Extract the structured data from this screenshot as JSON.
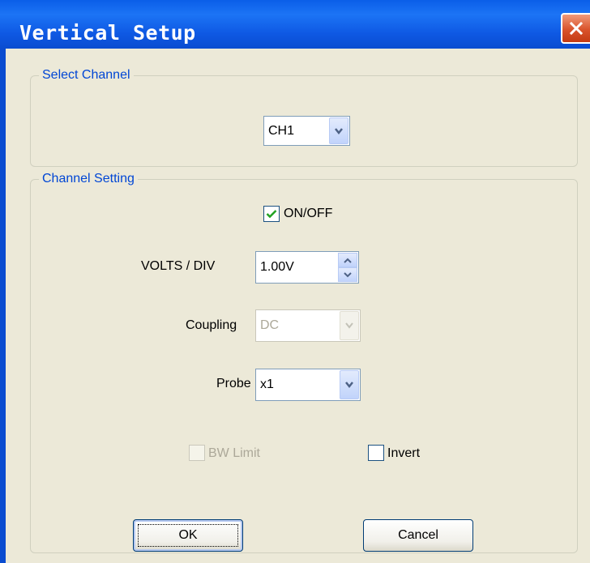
{
  "window": {
    "title": "Vertical Setup"
  },
  "select_channel": {
    "group_label": "Select Channel",
    "channel_value": "CH1"
  },
  "channel_setting": {
    "group_label": "Channel Setting",
    "on_off_label": "ON/OFF",
    "on_off_checked": true,
    "volts_div_label": "VOLTS / DIV",
    "volts_div_value": "1.00V",
    "coupling_label": "Coupling",
    "coupling_value": "DC",
    "probe_label": "Probe",
    "probe_value": "x1",
    "bw_limit_label": "BW Limit",
    "invert_label": "Invert"
  },
  "buttons": {
    "ok_label": "OK",
    "cancel_label": "Cancel"
  },
  "colors": {
    "titlebar": "#0a5ee8",
    "group_label": "#0046d5",
    "checkmark": "#21a121",
    "close_button": "#d9532c"
  }
}
